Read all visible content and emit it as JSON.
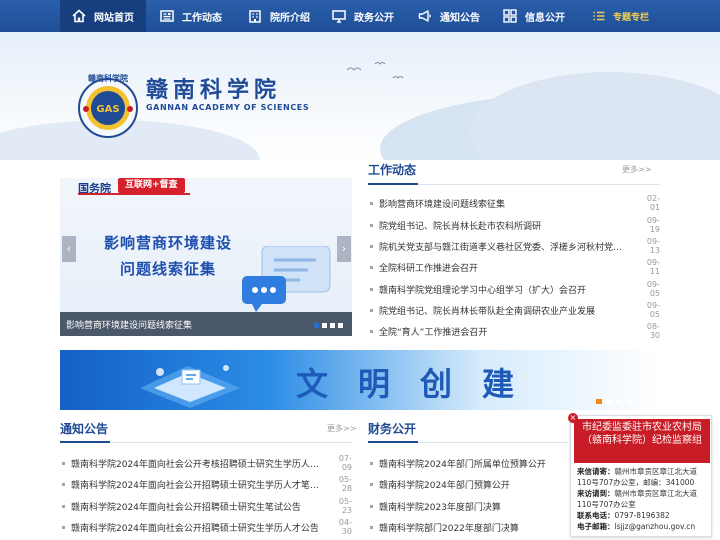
{
  "nav": {
    "items": [
      {
        "label": "网站首页",
        "icon": "home-icon"
      },
      {
        "label": "工作动态",
        "icon": "news-icon"
      },
      {
        "label": "院所介绍",
        "icon": "building-icon"
      },
      {
        "label": "政务公开",
        "icon": "monitor-icon"
      },
      {
        "label": "通知公告",
        "icon": "megaphone-icon"
      },
      {
        "label": "信息公开",
        "icon": "grid-icon"
      },
      {
        "label": "专题专栏",
        "icon": "list-icon"
      }
    ]
  },
  "header": {
    "title": "赣南科学院",
    "subtitle": "GANNAN ACADEMY OF SCIENCES",
    "seal_text": "赣南科学院"
  },
  "slider": {
    "source": "国务院",
    "tag": "互联网+督查",
    "headline_line1": "影响营商环境建设",
    "headline_line2": "问题线索征集",
    "caption": "影响营商环境建设问题线索征集",
    "prev": "‹",
    "next": "›"
  },
  "work_news": {
    "title": "工作动态",
    "more": "更多>>",
    "items": [
      {
        "title": "影响营商环境建设问题线索征集",
        "date": "02-01"
      },
      {
        "title": "院党组书记、院长肖林长赴市农科所调研",
        "date": "09-19"
      },
      {
        "title": "院机关党支部与赣江街道孝义巷社区党委、浮槎乡河秋村党…",
        "date": "09-13"
      },
      {
        "title": "全院科研工作推进会召开",
        "date": "09-11"
      },
      {
        "title": "赣南科学院党组理论学习中心组学习（扩大）会召开",
        "date": "09-05"
      },
      {
        "title": "院党组书记、院长肖林长带队赴全南调研农业产业发展",
        "date": "09-05"
      },
      {
        "title": "全院“育人”工作推进会召开",
        "date": "08-30"
      }
    ]
  },
  "banner": {
    "text": "文明创建"
  },
  "notices": {
    "title": "通知公告",
    "more": "更多>>",
    "items": [
      {
        "title": "赣南科学院2024年面向社会公开考核招聘硕士研究生学历人…",
        "date": "07-09"
      },
      {
        "title": "赣南科学院2024年面向社会公开招聘硕士研究生学历人才笔…",
        "date": "05-28"
      },
      {
        "title": "赣南科学院2024年面向社会公开招聘硕士研究生笔试公告",
        "date": "05-23"
      },
      {
        "title": "赣南科学院2024年面向社会公开招聘硕士研究生学历人才公告",
        "date": "04-30"
      }
    ]
  },
  "finance": {
    "title": "财务公开",
    "items": [
      {
        "title": "赣南科学院2024年部门所属单位预算公开"
      },
      {
        "title": "赣南科学院2024年部门预算公开"
      },
      {
        "title": "赣南科学院2023年度部门决算"
      },
      {
        "title": "赣南科学院部门2022年度部门决算"
      }
    ]
  },
  "popup": {
    "close": "×",
    "title": "市纪委监委驻市农业农村局（赣南科学院）纪检监察组",
    "letters_label": "来信请寄：",
    "letters_value": "赣州市章贡区章江北大道110号707办公室，邮编：341000",
    "visit_label": "来访请到：",
    "visit_value": "赣州市章贡区章江北大道110号707办公室",
    "phone_label": "联系电话：",
    "phone_value": "0797-8196382",
    "email_label": "电子邮箱：",
    "email_value": "lsjjz@ganzhou.gov.cn"
  },
  "colors": {
    "nav_bg": "#2a5fab",
    "brand_blue": "#1f4a94",
    "alert_red": "#c81d26",
    "special_gold": "#f2cf52"
  }
}
